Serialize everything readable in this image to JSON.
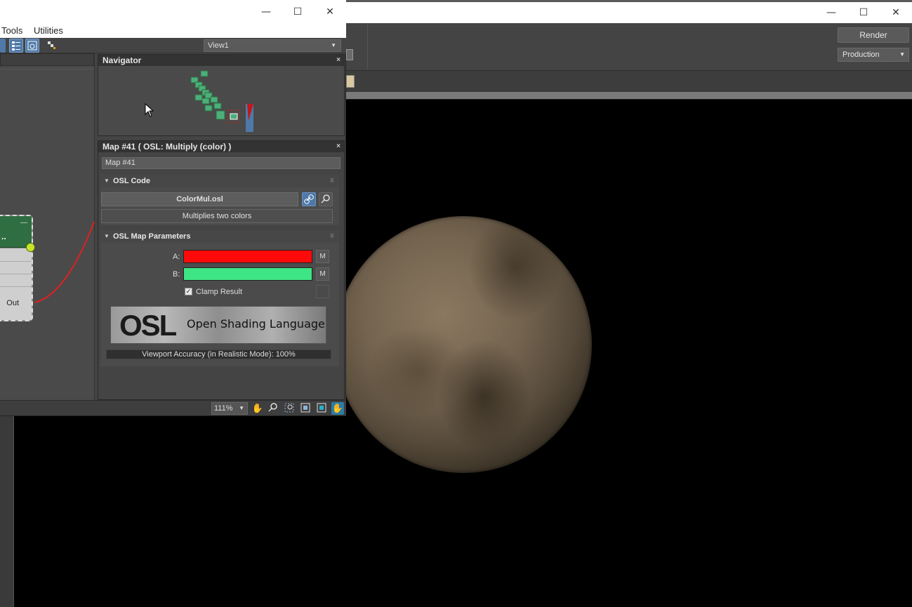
{
  "render_window": {
    "buttons": {
      "render": "Render",
      "production": "Production"
    },
    "window_controls": {
      "minimize": "—",
      "maximize": "☐",
      "close": "✕"
    }
  },
  "slate_editor": {
    "window_controls": {
      "minimize": "—",
      "maximize": "☐",
      "close": "✕"
    },
    "menu": [
      "Tools",
      "Utilities"
    ],
    "view_dropdown": "View1",
    "node": {
      "title_dots": "..",
      "out_label": "Out",
      "minimize": "—"
    },
    "navigator": {
      "title": "Navigator",
      "close": "×"
    },
    "param_panel": {
      "title": "Map #41  ( OSL: Multiply (color) )",
      "close": "×",
      "map_name": "Map #41",
      "osl_code": {
        "heading": "OSL Code",
        "file": "ColorMul.osl",
        "description": "Multiplies two colors"
      },
      "map_params": {
        "heading": "OSL Map Parameters",
        "a_label": "A:",
        "b_label": "B:",
        "a_color": "#ff0a0a",
        "b_color": "#3ee584",
        "m_label": "M",
        "clamp_label": "Clamp Result",
        "clamp_checked": true,
        "logo_mark": "OSL",
        "logo_text": "Open Shading Language",
        "accuracy": "Viewport Accuracy (in Realistic Mode): 100%"
      }
    },
    "status_bar": {
      "zoom": "111%"
    }
  },
  "colors": {
    "accent_blue": "#4f79a8",
    "node_header": "#2f6e41",
    "socket": "#c6e62a",
    "wire": "#e02020"
  }
}
